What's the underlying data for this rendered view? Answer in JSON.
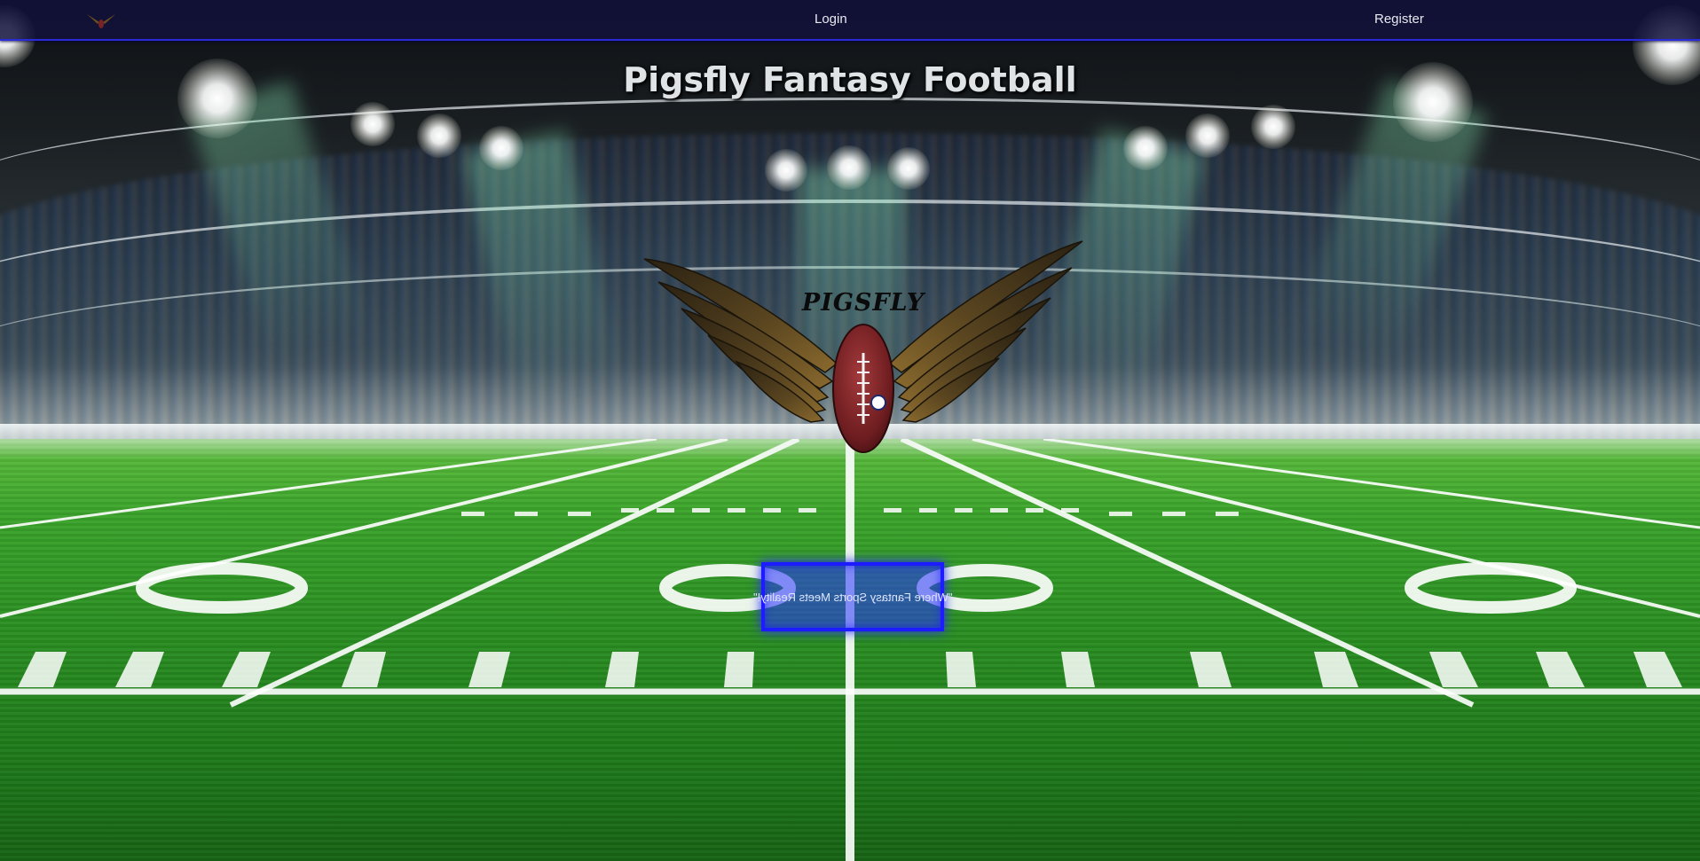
{
  "nav": {
    "logo_icon": "winged-football-icon",
    "login_label": "Login",
    "register_label": "Register"
  },
  "hero": {
    "title": "Pigsfly Fantasy Football",
    "emblem_text": "PIGSFLY",
    "emblem_icon": "winged-football-icon",
    "slogan": "\"Where Fantasy Sports Meets Reality!\""
  },
  "colors": {
    "nav_bg": "#12123c",
    "nav_border": "#2a2ad8",
    "slogan_border": "#1c1cff",
    "title_text": "#dfe3e6"
  }
}
